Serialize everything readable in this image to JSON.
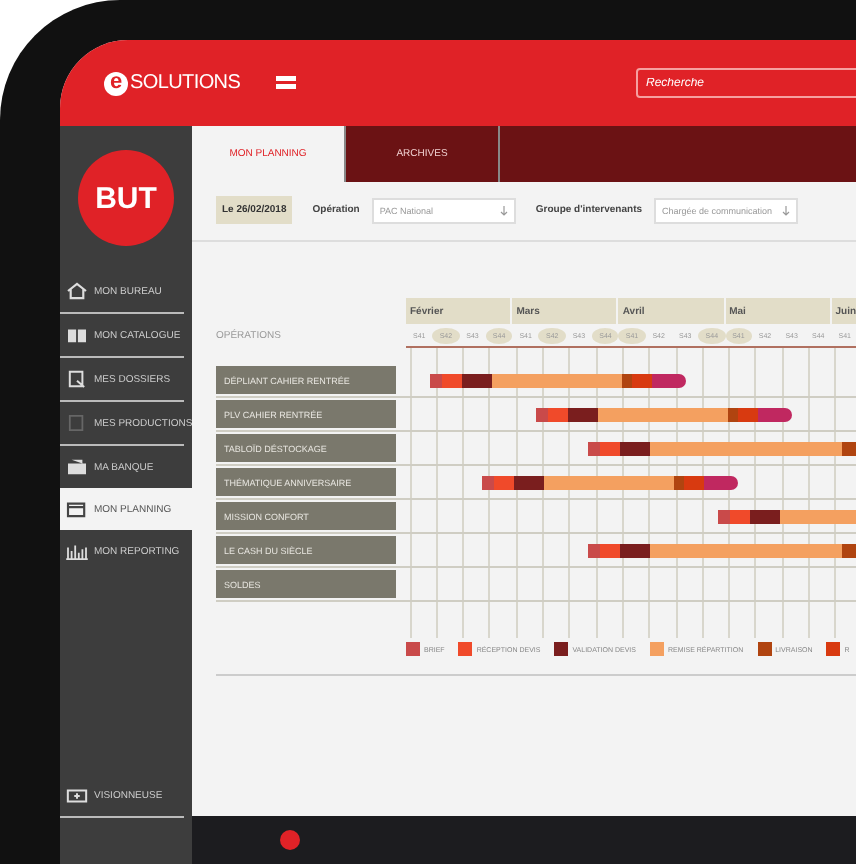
{
  "header": {
    "logo_letter": "e",
    "logo_text": "SOLUTIONS",
    "search": {
      "placeholder": "Recherche"
    }
  },
  "brand": {
    "label": "BUT"
  },
  "sidebar": {
    "items": [
      {
        "label": "MON BUREAU",
        "selected": false
      },
      {
        "label": "MON CATALOGUE",
        "selected": false
      },
      {
        "label": "MES DOSSIERS",
        "selected": false
      },
      {
        "label": "MES PRODUCTIONS",
        "selected": false
      },
      {
        "label": "MA BANQUE",
        "selected": false
      },
      {
        "label": "MON PLANNING",
        "selected": true
      },
      {
        "label": "MON REPORTING",
        "selected": false
      }
    ],
    "footer_item": {
      "label": "VISIONNEUSE"
    }
  },
  "tabs": [
    {
      "label": "MON PLANNING",
      "selected": true
    },
    {
      "label": "ARCHIVES",
      "selected": false
    }
  ],
  "filters": {
    "date": "Le 26/02/2018",
    "operation_label": "Opération",
    "operation_value": "PAC National",
    "group_label": "Groupe d'intervenants",
    "group_value": "Chargée de communication"
  },
  "planning": {
    "operations_label": "OPÉRATIONS",
    "months": [
      {
        "label": "Février",
        "weeks": [
          {
            "label": "S41",
            "highlighted": false
          },
          {
            "label": "S42",
            "highlighted": true
          },
          {
            "label": "S43",
            "highlighted": false
          },
          {
            "label": "S44",
            "highlighted": true
          }
        ]
      },
      {
        "label": "Mars",
        "weeks": [
          {
            "label": "S41",
            "highlighted": false
          },
          {
            "label": "S42",
            "highlighted": true
          },
          {
            "label": "S43",
            "highlighted": false
          },
          {
            "label": "S44",
            "highlighted": true
          }
        ]
      },
      {
        "label": "Avril",
        "weeks": [
          {
            "label": "S41",
            "highlighted": true
          },
          {
            "label": "S42",
            "highlighted": false
          },
          {
            "label": "S43",
            "highlighted": false
          },
          {
            "label": "S44",
            "highlighted": true
          }
        ]
      },
      {
        "label": "Mai",
        "weeks": [
          {
            "label": "S41",
            "highlighted": true
          },
          {
            "label": "S42",
            "highlighted": false
          },
          {
            "label": "S43",
            "highlighted": false
          },
          {
            "label": "S44",
            "highlighted": false
          }
        ]
      },
      {
        "label": "Juin",
        "weeks": [
          {
            "label": "S41",
            "highlighted": false
          }
        ]
      }
    ],
    "operations": [
      "DÉPLIANT CAHIER RENTRÉE",
      "PLV CAHIER RENTRÉE",
      "TABLOÏD DÉSTOCKAGE",
      "THÉMATIQUE ANNIVERSAIRE",
      "MISSION CONFORT",
      "LE CASH DU SIÈCLE",
      "SOLDES"
    ],
    "legend": [
      {
        "label": "BRIEF",
        "color": "#c94a4a"
      },
      {
        "label": "RÉCEPTION DEVIS",
        "color": "#f04a2a"
      },
      {
        "label": "VALIDATION DEVIS",
        "color": "#7a1e1e"
      },
      {
        "label": "REMISE RÉPARTITION",
        "color": "#f4a060"
      },
      {
        "label": "LIVRAISON",
        "color": "#b04410"
      },
      {
        "label": "R",
        "color": "#d83a10"
      }
    ]
  }
}
